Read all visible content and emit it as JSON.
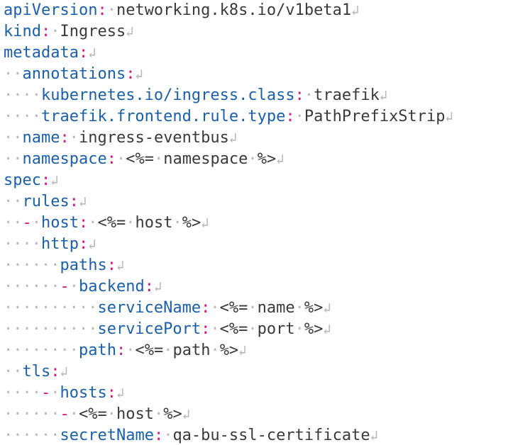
{
  "colors": {
    "key": "#1b5fa8",
    "punctuation": "#d8137e",
    "value": "#3a3a3a",
    "whitespace_marker": "#b7b7b7"
  },
  "symbols": {
    "newline": "↲"
  },
  "lines": [
    {
      "indent": "",
      "dash": "",
      "key": "apiVersion",
      "colon": ":",
      "space": "·",
      "value": "networking.k8s.io/v1beta1"
    },
    {
      "indent": "",
      "dash": "",
      "key": "kind",
      "colon": ":",
      "space": "·",
      "value": "Ingress"
    },
    {
      "indent": "",
      "dash": "",
      "key": "metadata",
      "colon": ":",
      "space": "",
      "value": ""
    },
    {
      "indent": "··",
      "dash": "",
      "key": "annotations",
      "colon": ":",
      "space": "",
      "value": ""
    },
    {
      "indent": "····",
      "dash": "",
      "key": "kubernetes.io/ingress.class",
      "colon": ":",
      "space": "·",
      "value": "traefik"
    },
    {
      "indent": "····",
      "dash": "",
      "key": "traefik.frontend.rule.type",
      "colon": ":",
      "space": "·",
      "value": "PathPrefixStrip"
    },
    {
      "indent": "··",
      "dash": "",
      "key": "name",
      "colon": ":",
      "space": "·",
      "value": "ingress-eventbus"
    },
    {
      "indent": "··",
      "dash": "",
      "key": "namespace",
      "colon": ":",
      "space": "·",
      "value": "<%=·namespace·%>"
    },
    {
      "indent": "",
      "dash": "",
      "key": "spec",
      "colon": ":",
      "space": "",
      "value": ""
    },
    {
      "indent": "··",
      "dash": "",
      "key": "rules",
      "colon": ":",
      "space": "",
      "value": ""
    },
    {
      "indent": "··",
      "dash": "-·",
      "key": "host",
      "colon": ":",
      "space": "·",
      "value": "<%=·host·%>"
    },
    {
      "indent": "····",
      "dash": "",
      "key": "http",
      "colon": ":",
      "space": "",
      "value": ""
    },
    {
      "indent": "······",
      "dash": "",
      "key": "paths",
      "colon": ":",
      "space": "",
      "value": ""
    },
    {
      "indent": "······",
      "dash": "-·",
      "key": "backend",
      "colon": ":",
      "space": "",
      "value": ""
    },
    {
      "indent": "··········",
      "dash": "",
      "key": "serviceName",
      "colon": ":",
      "space": "·",
      "value": "<%=·name·%>"
    },
    {
      "indent": "··········",
      "dash": "",
      "key": "servicePort",
      "colon": ":",
      "space": "·",
      "value": "<%=·port·%>"
    },
    {
      "indent": "········",
      "dash": "",
      "key": "path",
      "colon": ":",
      "space": "·",
      "value": "<%=·path·%>"
    },
    {
      "indent": "··",
      "dash": "",
      "key": "tls",
      "colon": ":",
      "space": "",
      "value": ""
    },
    {
      "indent": "····",
      "dash": "-·",
      "key": "hosts",
      "colon": ":",
      "space": "",
      "value": ""
    },
    {
      "indent": "······",
      "dash": "-·",
      "key": "",
      "colon": "",
      "space": "",
      "value": "<%=·host·%>"
    },
    {
      "indent": "······",
      "dash": "",
      "key": "secretName",
      "colon": ":",
      "space": "·",
      "value": "qa-bu-ssl-certificate"
    }
  ]
}
